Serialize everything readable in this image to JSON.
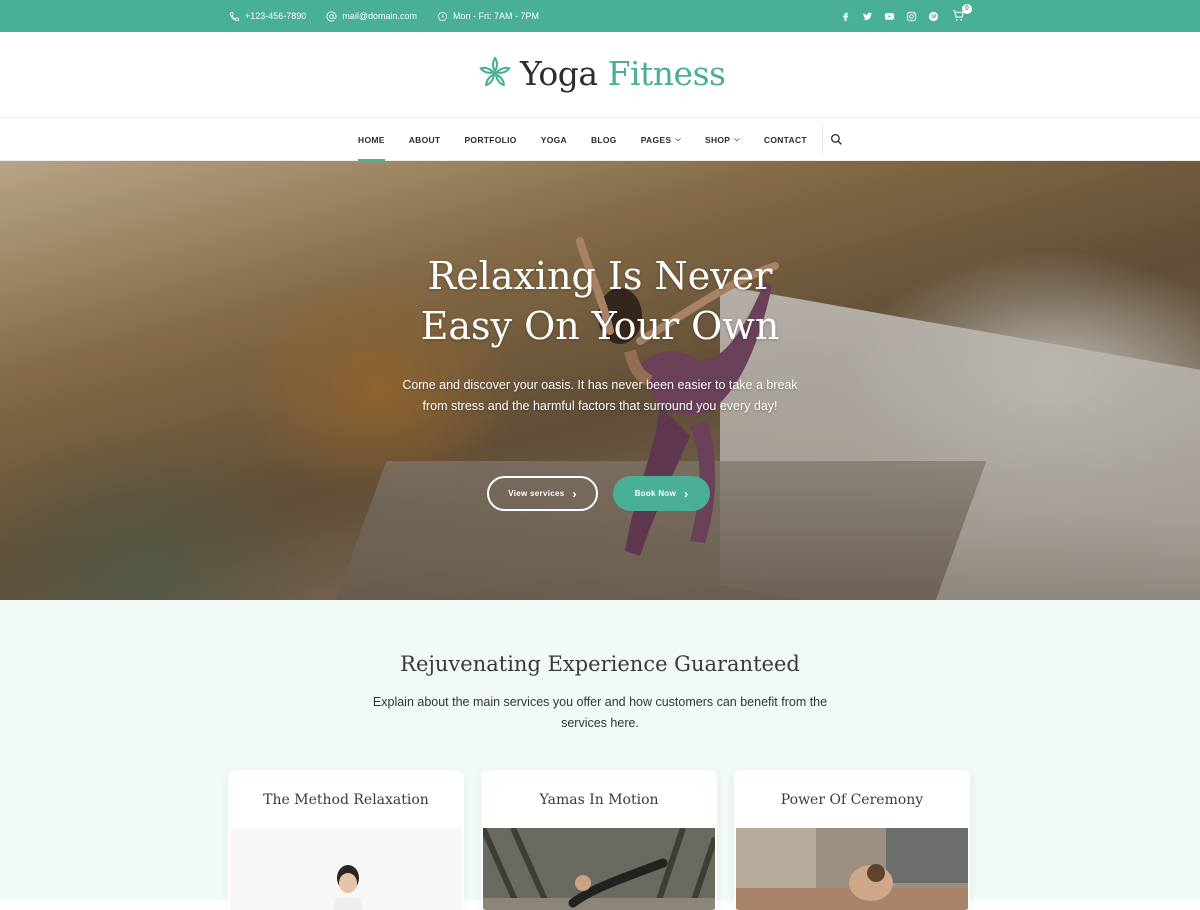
{
  "topbar": {
    "phone": "+123-456-7890",
    "email": "mail@domain.com",
    "hours": "Mon - Fri: 7AM - 7PM",
    "social": [
      "facebook-icon",
      "twitter-icon",
      "youtube-icon",
      "instagram-icon",
      "pinterest-icon"
    ],
    "cart_count": "0"
  },
  "logo": {
    "word1": "Yoga",
    "word2": "Fitness"
  },
  "nav": {
    "items": [
      {
        "label": "HOME"
      },
      {
        "label": "ABOUT"
      },
      {
        "label": "PORTFOLIO"
      },
      {
        "label": "YOGA"
      },
      {
        "label": "BLOG"
      },
      {
        "label": "PAGES"
      },
      {
        "label": "SHOP"
      },
      {
        "label": "CONTACT"
      }
    ]
  },
  "hero": {
    "title_line1": "Relaxing Is Never",
    "title_line2": "Easy On Your Own",
    "text": "Come and discover your oasis. It has never been easier to take a break from stress and the harmful factors that surround you every day!",
    "btn_view": "View services",
    "btn_book": "Book Now"
  },
  "services": {
    "heading": "Rejuvenating Experience Guaranteed",
    "lead": "Explain about the main services you offer and how customers can benefit from the services here.",
    "cards": [
      {
        "title": "The Method Relaxation"
      },
      {
        "title": "Yamas In Motion"
      },
      {
        "title": "Power Of Ceremony"
      }
    ]
  },
  "colors": {
    "accent": "#49b096",
    "text_dark": "#2d2d2d",
    "section_bg": "#f2faf8"
  }
}
